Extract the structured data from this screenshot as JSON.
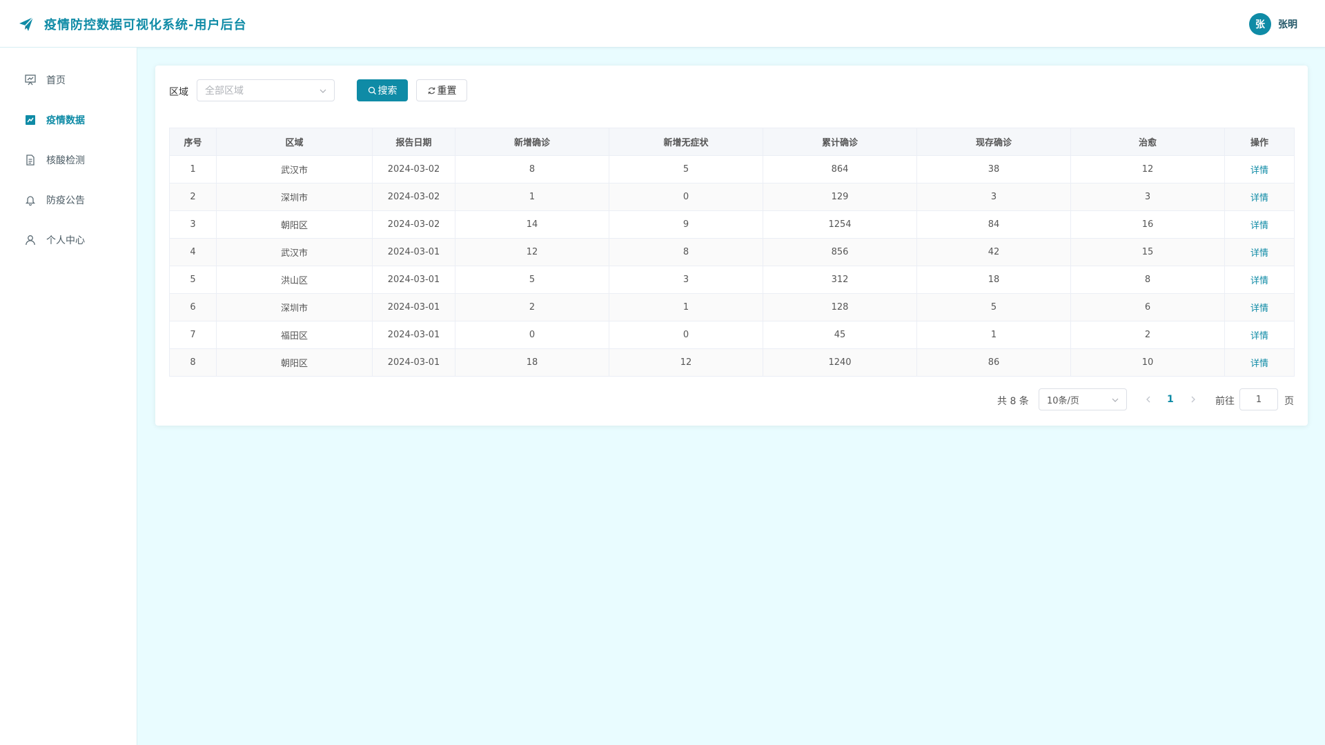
{
  "app": {
    "title": "疫情防控数据可视化系统-用户后台",
    "brand_color": "#0f8ba6",
    "logo_icon": "paper-plane-icon"
  },
  "user": {
    "avatar_text": "张",
    "name": "张明"
  },
  "sidebar": {
    "items": [
      {
        "label": "首页",
        "icon": "presentation-chart-icon",
        "active": false
      },
      {
        "label": "疫情数据",
        "icon": "line-chart-icon",
        "active": true
      },
      {
        "label": "核酸检测",
        "icon": "document-icon",
        "active": false
      },
      {
        "label": "防疫公告",
        "icon": "bell-icon",
        "active": false
      },
      {
        "label": "个人中心",
        "icon": "user-icon",
        "active": false
      }
    ]
  },
  "filter": {
    "label": "区域",
    "region_placeholder": "全部区域",
    "search_label": "搜索",
    "reset_label": "重置"
  },
  "table": {
    "columns": [
      "序号",
      "区域",
      "报告日期",
      "新增确诊",
      "新增无症状",
      "累计确诊",
      "现存确诊",
      "治愈",
      "操作"
    ],
    "action_label": "详情",
    "rows": [
      [
        "1",
        "武汉市",
        "2024-03-02",
        "8",
        "5",
        "864",
        "38",
        "12"
      ],
      [
        "2",
        "深圳市",
        "2024-03-02",
        "1",
        "0",
        "129",
        "3",
        "3"
      ],
      [
        "3",
        "朝阳区",
        "2024-03-02",
        "14",
        "9",
        "1254",
        "84",
        "16"
      ],
      [
        "4",
        "武汉市",
        "2024-03-01",
        "12",
        "8",
        "856",
        "42",
        "15"
      ],
      [
        "5",
        "洪山区",
        "2024-03-01",
        "5",
        "3",
        "312",
        "18",
        "8"
      ],
      [
        "6",
        "深圳市",
        "2024-03-01",
        "2",
        "1",
        "128",
        "5",
        "6"
      ],
      [
        "7",
        "福田区",
        "2024-03-01",
        "0",
        "0",
        "45",
        "1",
        "2"
      ],
      [
        "8",
        "朝阳区",
        "2024-03-01",
        "18",
        "12",
        "1240",
        "86",
        "10"
      ]
    ]
  },
  "pagination": {
    "total_text": "共 8 条",
    "page_size": "10条/页",
    "current_page": "1",
    "goto_label": "前往",
    "goto_value": "1",
    "page_suffix": "页"
  }
}
